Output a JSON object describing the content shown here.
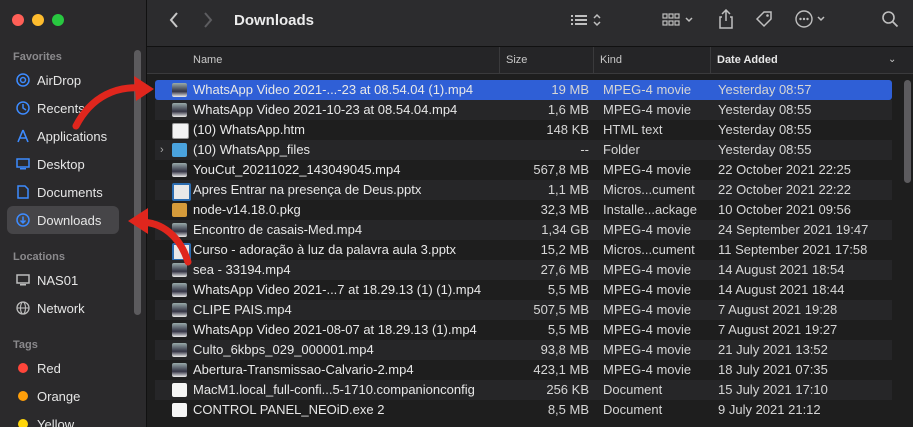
{
  "window": {
    "title": "Downloads"
  },
  "colors": {
    "selection": "#2f5fd6",
    "arrow": "#e0261d",
    "close": "#ff5f57",
    "minimize": "#febc2e",
    "zoom": "#28c840"
  },
  "sidebar": {
    "favorites_label": "Favorites",
    "favorites": [
      {
        "label": "AirDrop",
        "icon": "airdrop-icon"
      },
      {
        "label": "Recents",
        "icon": "clock-icon"
      },
      {
        "label": "Applications",
        "icon": "applications-icon"
      },
      {
        "label": "Desktop",
        "icon": "desktop-icon"
      },
      {
        "label": "Documents",
        "icon": "document-icon"
      },
      {
        "label": "Downloads",
        "icon": "download-icon",
        "active": true
      }
    ],
    "locations_label": "Locations",
    "locations": [
      {
        "label": "NAS01",
        "icon": "display-icon"
      },
      {
        "label": "Network",
        "icon": "globe-icon"
      }
    ],
    "tags_label": "Tags",
    "tags": [
      {
        "label": "Red",
        "color": "#ff453a"
      },
      {
        "label": "Orange",
        "color": "#ff9f0a"
      },
      {
        "label": "Yellow",
        "color": "#ffd60a"
      }
    ]
  },
  "table": {
    "columns": {
      "name": "Name",
      "size": "Size",
      "kind": "Kind",
      "date": "Date Added"
    },
    "rows": [
      {
        "name": "WhatsApp Video 2021-...-23 at 08.54.04 (1).mp4",
        "size": "19 MB",
        "kind": "MPEG-4 movie",
        "date": "Yesterday 08:57",
        "icon": "video-thumb-icon",
        "selected": true
      },
      {
        "name": "WhatsApp Video 2021-10-23 at 08.54.04.mp4",
        "size": "1,6 MB",
        "kind": "MPEG-4 movie",
        "date": "Yesterday 08:55",
        "icon": "video-thumb-icon"
      },
      {
        "name": "(10) WhatsApp.htm",
        "size": "148 KB",
        "kind": "HTML text",
        "date": "Yesterday 08:55",
        "icon": "html-file-icon"
      },
      {
        "name": "(10) WhatsApp_files",
        "size": "--",
        "kind": "Folder",
        "date": "Yesterday 08:55",
        "icon": "folder-icon",
        "folder": true
      },
      {
        "name": "YouCut_20211022_143049045.mp4",
        "size": "567,8 MB",
        "kind": "MPEG-4 movie",
        "date": "22 October 2021 22:25",
        "icon": "video-thumb-icon"
      },
      {
        "name": "Apres Entrar na presença de Deus.pptx",
        "size": "1,1 MB",
        "kind": "Micros...cument",
        "date": "22 October 2021 22:22",
        "icon": "presentation-icon"
      },
      {
        "name": "node-v14.18.0.pkg",
        "size": "32,3 MB",
        "kind": "Installe...ackage",
        "date": "10 October 2021 09:56",
        "icon": "package-icon"
      },
      {
        "name": "Encontro de casais-Med.mp4",
        "size": "1,34 GB",
        "kind": "MPEG-4 movie",
        "date": "24 September 2021 19:47",
        "icon": "video-thumb-icon"
      },
      {
        "name": "Curso - adoração à luz da palavra aula 3.pptx",
        "size": "15,2 MB",
        "kind": "Micros...cument",
        "date": "11 September 2021 17:58",
        "icon": "presentation-icon"
      },
      {
        "name": "sea - 33194.mp4",
        "size": "27,6 MB",
        "kind": "MPEG-4 movie",
        "date": "14 August 2021 18:54",
        "icon": "video-thumb-icon"
      },
      {
        "name": "WhatsApp Video 2021-...7 at 18.29.13 (1) (1).mp4",
        "size": "5,5 MB",
        "kind": "MPEG-4 movie",
        "date": "14 August 2021 18:44",
        "icon": "video-thumb-icon"
      },
      {
        "name": "CLIPE PAIS.mp4",
        "size": "507,5 MB",
        "kind": "MPEG-4 movie",
        "date": "7 August 2021 19:28",
        "icon": "video-thumb-icon"
      },
      {
        "name": "WhatsApp Video 2021-08-07 at 18.29.13 (1).mp4",
        "size": "5,5 MB",
        "kind": "MPEG-4 movie",
        "date": "7 August 2021 19:27",
        "icon": "video-thumb-icon"
      },
      {
        "name": "Culto_6kbps_029_000001.mp4",
        "size": "93,8 MB",
        "kind": "MPEG-4 movie",
        "date": "21 July 2021 13:52",
        "icon": "video-thumb-icon"
      },
      {
        "name": "Abertura-Transmissao-Calvario-2.mp4",
        "size": "423,1 MB",
        "kind": "MPEG-4 movie",
        "date": "18 July 2021 07:35",
        "icon": "video-thumb-icon"
      },
      {
        "name": "MacM1.local_full-confi...5-1710.companionconfig",
        "size": "256 KB",
        "kind": "Document",
        "date": "15 July 2021 17:10",
        "icon": "document-file-icon"
      },
      {
        "name": "CONTROL PANEL_NEOiD.exe 2",
        "size": "8,5 MB",
        "kind": "Document",
        "date": "9 July 2021 21:12",
        "icon": "document-file-icon"
      }
    ]
  }
}
